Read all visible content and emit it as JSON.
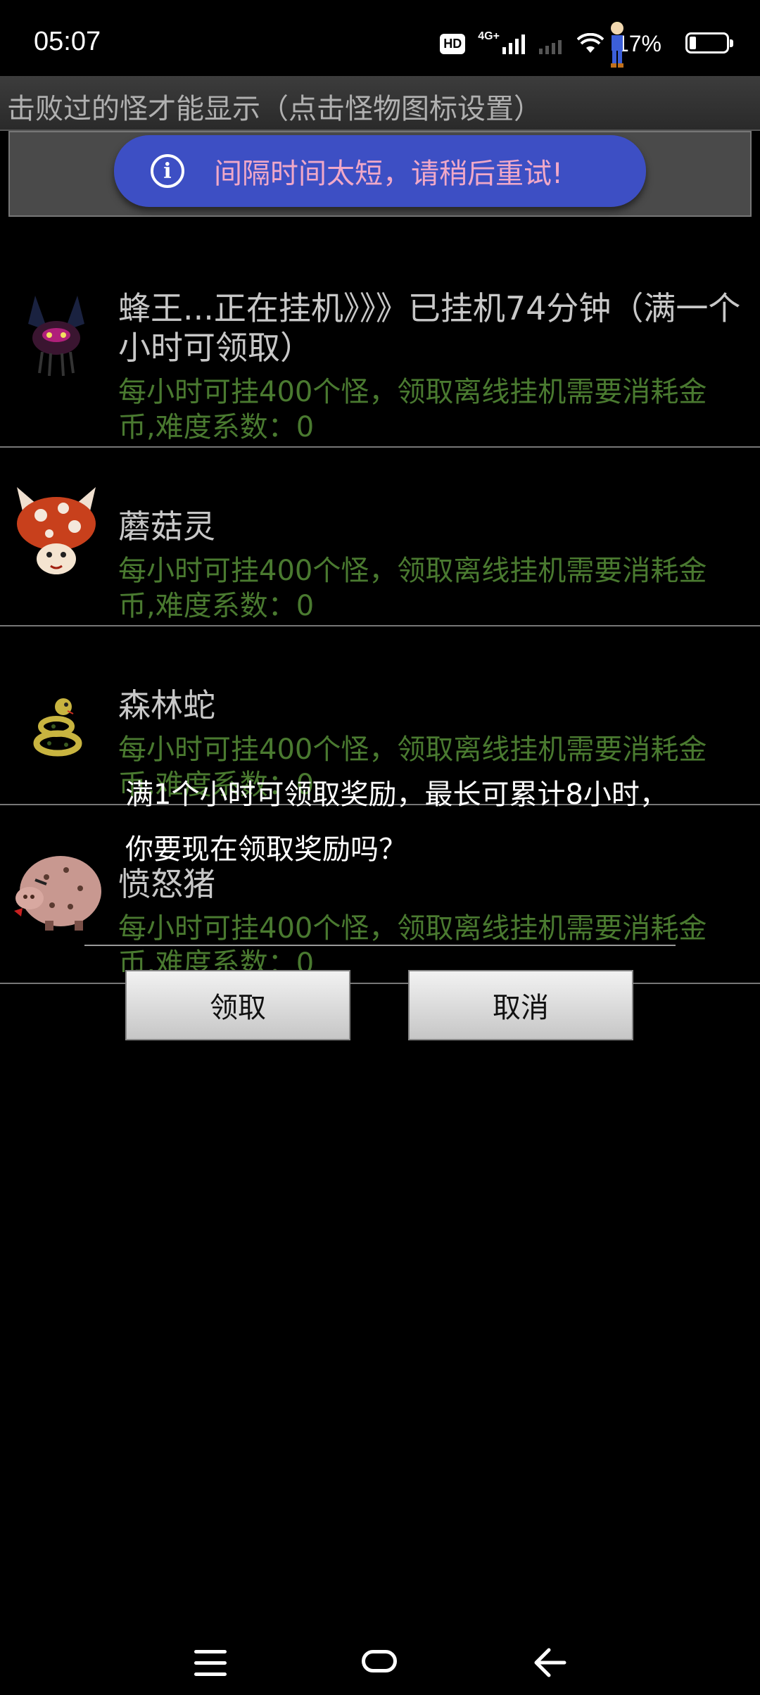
{
  "status_bar": {
    "time": "05:07",
    "hd_label": "HD",
    "network_label": "4G+",
    "battery_percent": "17%",
    "battery_level": 0.17
  },
  "hint_bar": {
    "text": "击败过的怪才能显示（点击怪物图标设置）"
  },
  "toast": {
    "icon": "info-icon",
    "message": "间隔时间太短，请稍后重试!"
  },
  "monsters": [
    {
      "name": "蜂王...正在挂机》》》已挂机74分钟（满一个小时可领取）",
      "desc": "每小时可挂400个怪，领取离线挂机需要消耗金币,难度系数：0",
      "icon": "bee-king-icon"
    },
    {
      "name": "蘑菇灵",
      "desc": "每小时可挂400个怪，领取离线挂机需要消耗金币,难度系数：0",
      "icon": "mushroom-spirit-icon"
    },
    {
      "name": "森林蛇",
      "desc": "每小时可挂400个怪，领取离线挂机需要消耗金币,难度系数：0",
      "icon": "forest-snake-icon"
    },
    {
      "name": "愤怒猪",
      "desc": "每小时可挂400个怪，领取离线挂机需要消耗金币,难度系数：0",
      "icon": "angry-pig-icon"
    }
  ],
  "dialog": {
    "message": "满1个小时可领取奖励，最长可累计8小时，你要现在领取奖励吗？",
    "confirm_label": "领取",
    "cancel_label": "取消"
  },
  "colors": {
    "background": "#000000",
    "toast_bg": "#3d4fc4",
    "toast_text": "#f0a8c8",
    "desc_text": "#4a7a30",
    "name_text": "#c8c8c8"
  }
}
